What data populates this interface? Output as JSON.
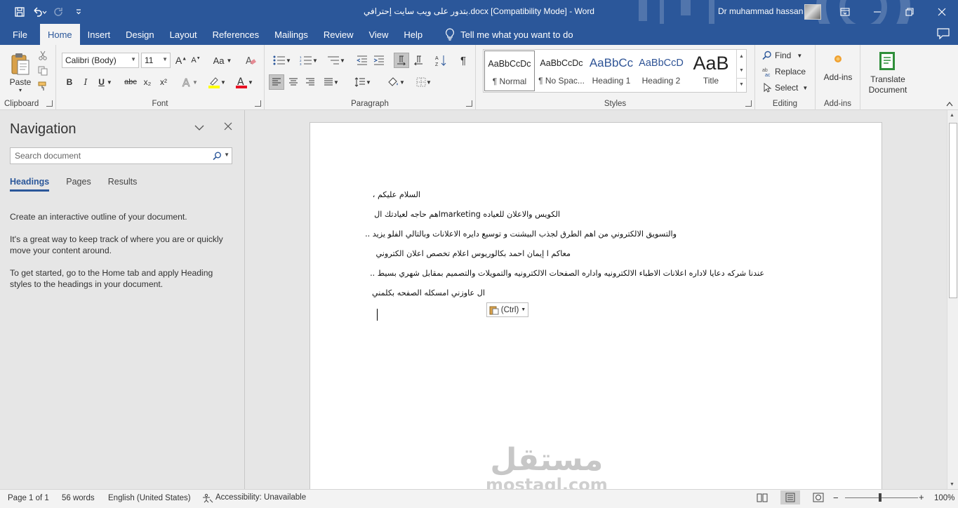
{
  "window": {
    "title": "بتدور على ويب سايت إحترافي.docx [Compatibility Mode]  -  Word",
    "user": "Dr muhammad hassan",
    "accent": "#2b579a"
  },
  "tabs": [
    "File",
    "Home",
    "Insert",
    "Design",
    "Layout",
    "References",
    "Mailings",
    "Review",
    "View",
    "Help"
  ],
  "tell_me": "Tell me what you want to do",
  "ribbon": {
    "clipboard": {
      "label": "Clipboard",
      "paste": "Paste"
    },
    "font": {
      "label": "Font",
      "family": "Calibri (Body)",
      "size": "11",
      "bold": "B",
      "italic": "I",
      "underline": "U",
      "strike": "abc",
      "sub": "x₂",
      "sup": "x²",
      "change_case": "Aa"
    },
    "paragraph": {
      "label": "Paragraph"
    },
    "styles": {
      "label": "Styles",
      "items": [
        {
          "preview": "AaBbCcDc",
          "name": "¶ Normal"
        },
        {
          "preview": "AaBbCcDc",
          "name": "¶ No Spac..."
        },
        {
          "preview": "AaBbCc",
          "name": "Heading 1"
        },
        {
          "preview": "AaBbCcD",
          "name": "Heading 2"
        },
        {
          "preview": "AaB",
          "name": "Title"
        }
      ]
    },
    "editing": {
      "label": "Editing",
      "find": "Find",
      "replace": "Replace",
      "select": "Select"
    },
    "addins": {
      "label": "Add-ins",
      "button": "Add-ins"
    },
    "translate": {
      "line1": "Translate",
      "line2": "Document"
    }
  },
  "navigation": {
    "title": "Navigation",
    "search_placeholder": "Search document",
    "tabs": [
      "Headings",
      "Pages",
      "Results"
    ],
    "p1": "Create an interactive outline of your document.",
    "p2": "It's a great way to keep track of where you are or quickly move your content around.",
    "p3": "To get started, go to the Home tab and apply Heading styles to the headings in your document."
  },
  "document": {
    "lines": [
      "السلام عليكم ،",
      "الكويس والاعلان للعياده marketingاهم حاجه لعيادتك ال",
      "والتسويق الالكتروني من اهم الطرق لجذب البيشنت و توسيع دايره الاعلانات وبالتالي الفلو يزيد ..",
      "معاكم ا إيمان احمد بكالوريوس اعلام تخصص اعلان الكتروني",
      "عندنا شركه دعايا لاداره اعلانات الاطباء الالكترونيه واداره الصفحات الالكترونيه والتمويلات والتصميم بمقابل شهري بسيط ..",
      "ال عاوزني امسكله الصفحه بكلمني"
    ],
    "paste_options": "(Ctrl)",
    "watermark_ar": "مستقل",
    "watermark_en": "mostaql.com"
  },
  "status": {
    "page": "Page 1 of 1",
    "words": "56 words",
    "language": "English (United States)",
    "accessibility": "Accessibility: Unavailable",
    "zoom": "100%"
  }
}
